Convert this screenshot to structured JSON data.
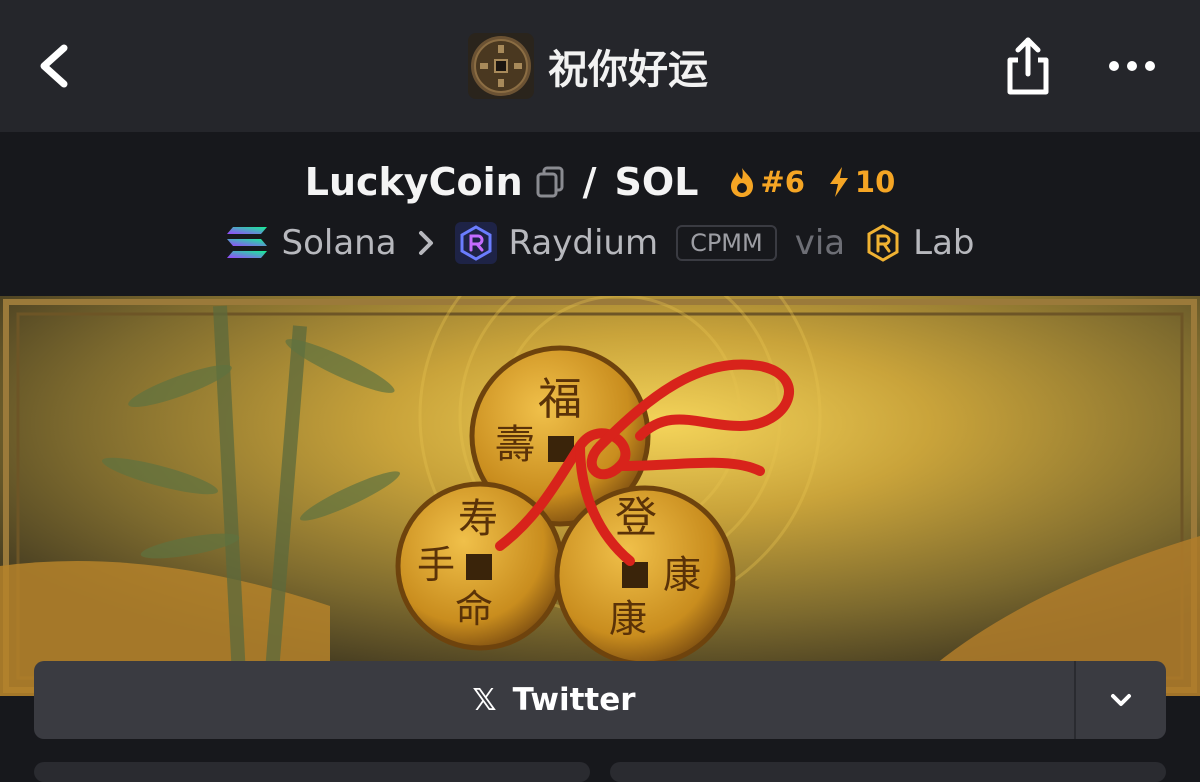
{
  "header": {
    "title": "祝你好运",
    "icons": {
      "back": "chevron-left-icon",
      "share": "share-icon",
      "more": "more-dots-icon"
    }
  },
  "pair": {
    "base": "LuckyCoin",
    "separator": "/",
    "quote": "SOL",
    "rank": "#6",
    "boosts": "10"
  },
  "chain": {
    "network": "Solana",
    "dex": "Raydium",
    "pool_type": "CPMM",
    "via": "via",
    "launchpad": "Lab"
  },
  "banner": {
    "coin_characters": {
      "top": [
        "福",
        "壽"
      ],
      "left": [
        "寿",
        "手",
        "命"
      ],
      "right": [
        "登",
        "康",
        "康"
      ]
    }
  },
  "social": {
    "twitter_label": "Twitter",
    "x_glyph": "𝕏"
  },
  "colors": {
    "accent": "#f5a524",
    "topbar": "#25262b",
    "background": "#17181c",
    "button": "#3a3b41"
  }
}
